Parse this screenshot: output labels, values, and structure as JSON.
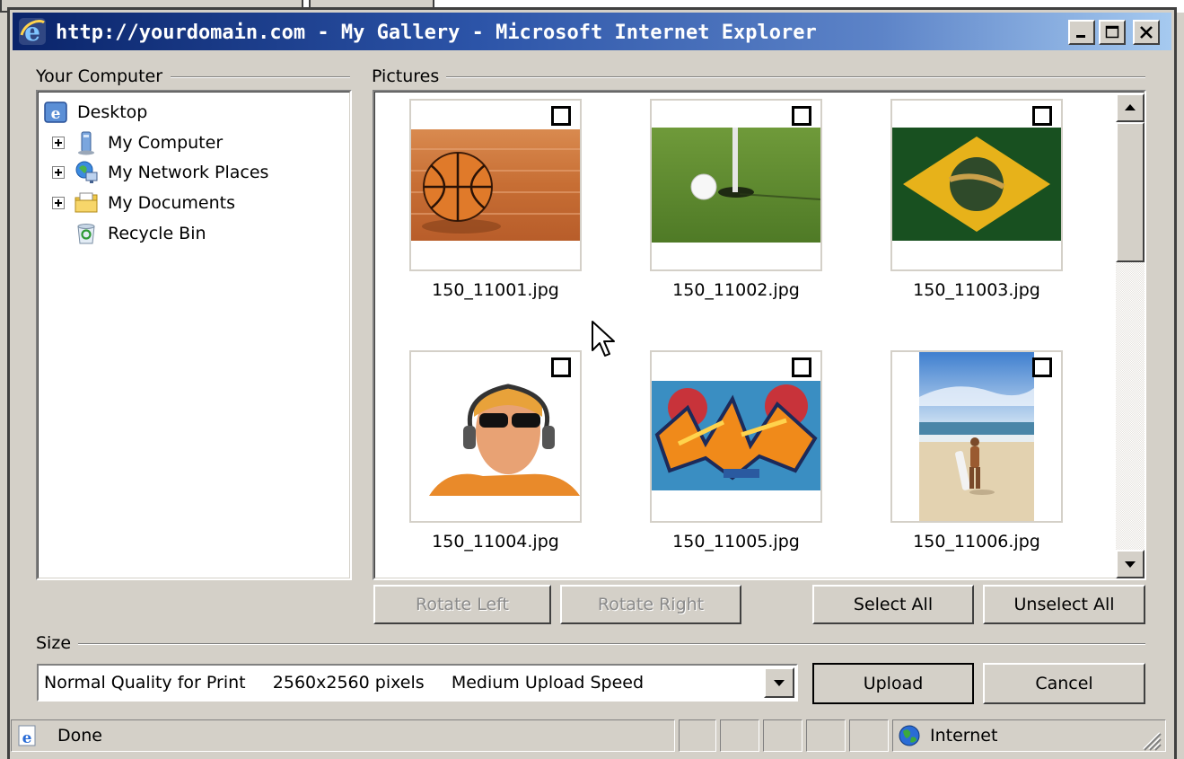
{
  "window": {
    "title": "http://yourdomain.com - My Gallery - Microsoft Internet Explorer",
    "icon": "ie-icon",
    "controls": [
      "minimize-icon",
      "maximize-icon",
      "close-icon"
    ]
  },
  "computer_group": {
    "label": "Your Computer",
    "tree": [
      {
        "label": "Desktop",
        "icon": "desktop-icon",
        "expandable": false
      },
      {
        "label": "My Computer",
        "icon": "computer-icon",
        "expandable": true
      },
      {
        "label": "My Network Places",
        "icon": "network-icon",
        "expandable": true
      },
      {
        "label": "My Documents",
        "icon": "documents-folder-icon",
        "expandable": true
      },
      {
        "label": "Recycle Bin",
        "icon": "recycle-bin-icon",
        "expandable": false
      }
    ]
  },
  "pictures_group": {
    "label": "Pictures",
    "items": [
      {
        "filename": "150_11001.jpg",
        "subject": "basketball",
        "checked": false
      },
      {
        "filename": "150_11002.jpg",
        "subject": "golf-ball",
        "checked": false
      },
      {
        "filename": "150_11003.jpg",
        "subject": "brazil-flag",
        "checked": false
      },
      {
        "filename": "150_11004.jpg",
        "subject": "man-with-headphones",
        "checked": false
      },
      {
        "filename": "150_11005.jpg",
        "subject": "graffiti",
        "checked": false
      },
      {
        "filename": "150_11006.jpg",
        "subject": "surfer-on-beach",
        "checked": false
      }
    ]
  },
  "actions": {
    "rotate_left": "Rotate Left",
    "rotate_right": "Rotate Right",
    "select_all": "Select All",
    "unselect_all": "Unselect All"
  },
  "size_group": {
    "label": "Size",
    "selected": "Normal Quality for Print     2560x2560 pixels     Medium Upload Speed"
  },
  "dialog_buttons": {
    "upload": "Upload",
    "cancel": "Cancel"
  },
  "statusbar": {
    "text": "Done",
    "zone": "Internet"
  },
  "colors": {
    "titlebar_start": "#0a246a",
    "titlebar_end": "#a6caf0",
    "face": "#d4d0c8"
  }
}
